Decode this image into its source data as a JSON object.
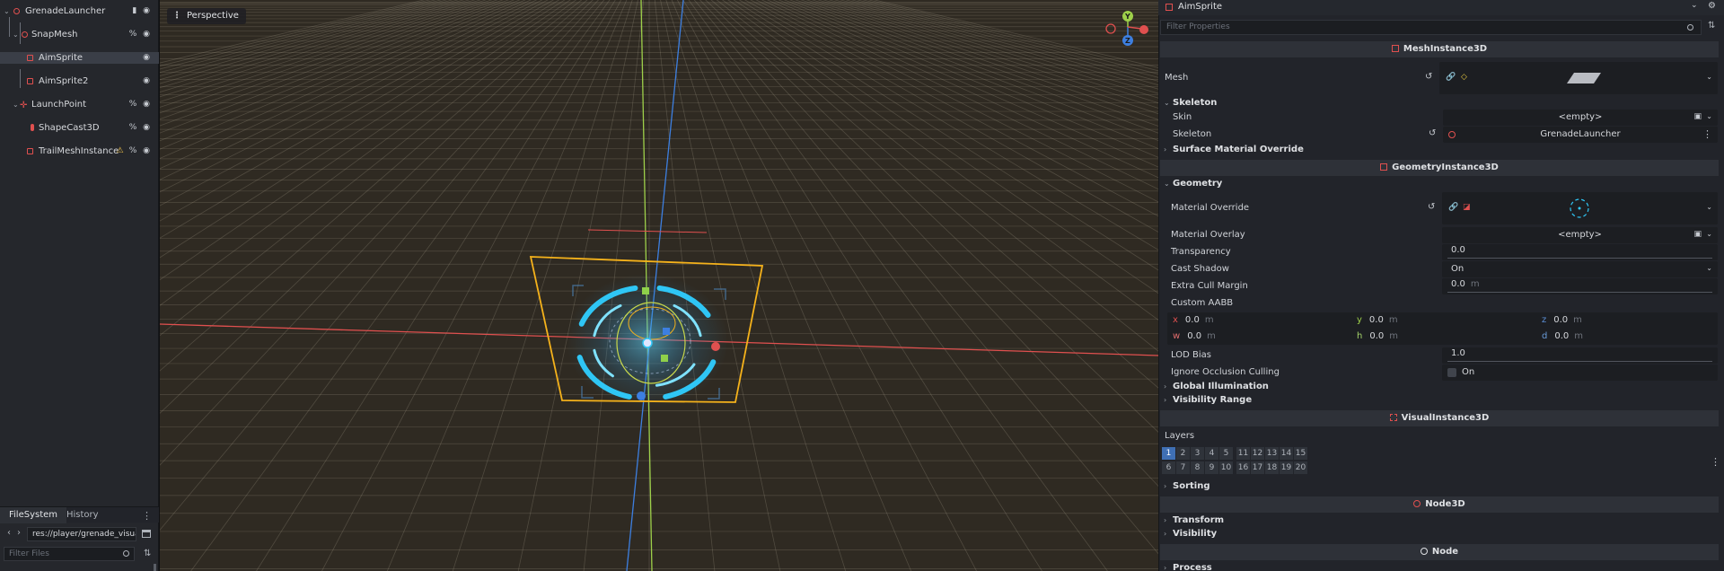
{
  "scene_tree": {
    "nodes": [
      {
        "name": "GrenadeLauncher",
        "icon": "sphere-node-icon",
        "depth": 0,
        "status": "▮ 👁"
      },
      {
        "name": "SnapMesh",
        "icon": "sphere-node-icon",
        "depth": 1,
        "status": "% 👁"
      },
      {
        "name": "AimSprite",
        "icon": "mesh-instance-icon",
        "depth": 2,
        "status": "👁",
        "selected": true
      },
      {
        "name": "AimSprite2",
        "icon": "mesh-instance-icon",
        "depth": 2,
        "status": "👁"
      },
      {
        "name": "LaunchPoint",
        "icon": "marker-icon",
        "depth": 1,
        "status": "% 👁"
      },
      {
        "name": "ShapeCast3D",
        "icon": "shape-cast-icon",
        "depth": 2,
        "status": "% 👁"
      },
      {
        "name": "TrailMeshInstance",
        "icon": "mesh-instance-icon",
        "depth": 2,
        "status": "⚠ % 👁",
        "warning": true
      }
    ]
  },
  "filesystem": {
    "tabs": [
      "FileSystem",
      "History"
    ],
    "active_tab": "FileSystem",
    "path": "res://player/grenade_visual",
    "filter_placeholder": "Filter Files"
  },
  "viewport": {
    "camera_label": "Perspective",
    "gizmo": {
      "y": "Y",
      "z": "Z"
    }
  },
  "inspector": {
    "object_name": "AimSprite",
    "filter_placeholder": "Filter Properties",
    "headers": {
      "mesh_instance": "MeshInstance3D",
      "geometry_instance": "GeometryInstance3D",
      "visual_instance": "VisualInstance3D",
      "node3d": "Node3D",
      "node": "Node"
    },
    "mesh_label": "Mesh",
    "skeleton_section": "Skeleton",
    "skin_label": "Skin",
    "skin_value": "<empty>",
    "skeleton_label": "Skeleton",
    "skeleton_value": "GrenadeLauncher",
    "surface_override_section": "Surface Material Override",
    "geometry_section": "Geometry",
    "material_override_label": "Material Override",
    "material_overlay_label": "Material Overlay",
    "material_overlay_value": "<empty>",
    "transparency_label": "Transparency",
    "transparency_value": "0.0",
    "cast_shadow_label": "Cast Shadow",
    "cast_shadow_value": "On",
    "extra_cull_label": "Extra Cull Margin",
    "extra_cull_value": "0.0",
    "extra_cull_unit": "m",
    "custom_aabb_label": "Custom AABB",
    "aabb": {
      "x": "0.0",
      "y": "0.0",
      "z": "0.0",
      "w": "0.0",
      "h": "0.0",
      "d": "0.0",
      "unit": "m"
    },
    "lod_bias_label": "LOD Bias",
    "lod_bias_value": "1.0",
    "ignore_occlusion_label": "Ignore Occlusion Culling",
    "ignore_occlusion_value": "On",
    "global_illumination_section": "Global Illumination",
    "visibility_range_section": "Visibility Range",
    "layers_label": "Layers",
    "layers_row1": [
      "1",
      "2",
      "3",
      "4",
      "5",
      "11",
      "12",
      "13",
      "14",
      "15"
    ],
    "layers_row2": [
      "6",
      "7",
      "8",
      "9",
      "10",
      "16",
      "17",
      "18",
      "19",
      "20"
    ],
    "layers_enabled": [
      "1"
    ],
    "sorting_section": "Sorting",
    "transform_section": "Transform",
    "visibility_section": "Visibility",
    "process_section": "Process"
  },
  "colors": {
    "accent": "#3f6fb4",
    "selection_outline": "#f5b21b",
    "reticle": "#2fc6f5",
    "axis_x": "#e0504f",
    "axis_y": "#9ed04a",
    "axis_z": "#5b8fd6"
  }
}
